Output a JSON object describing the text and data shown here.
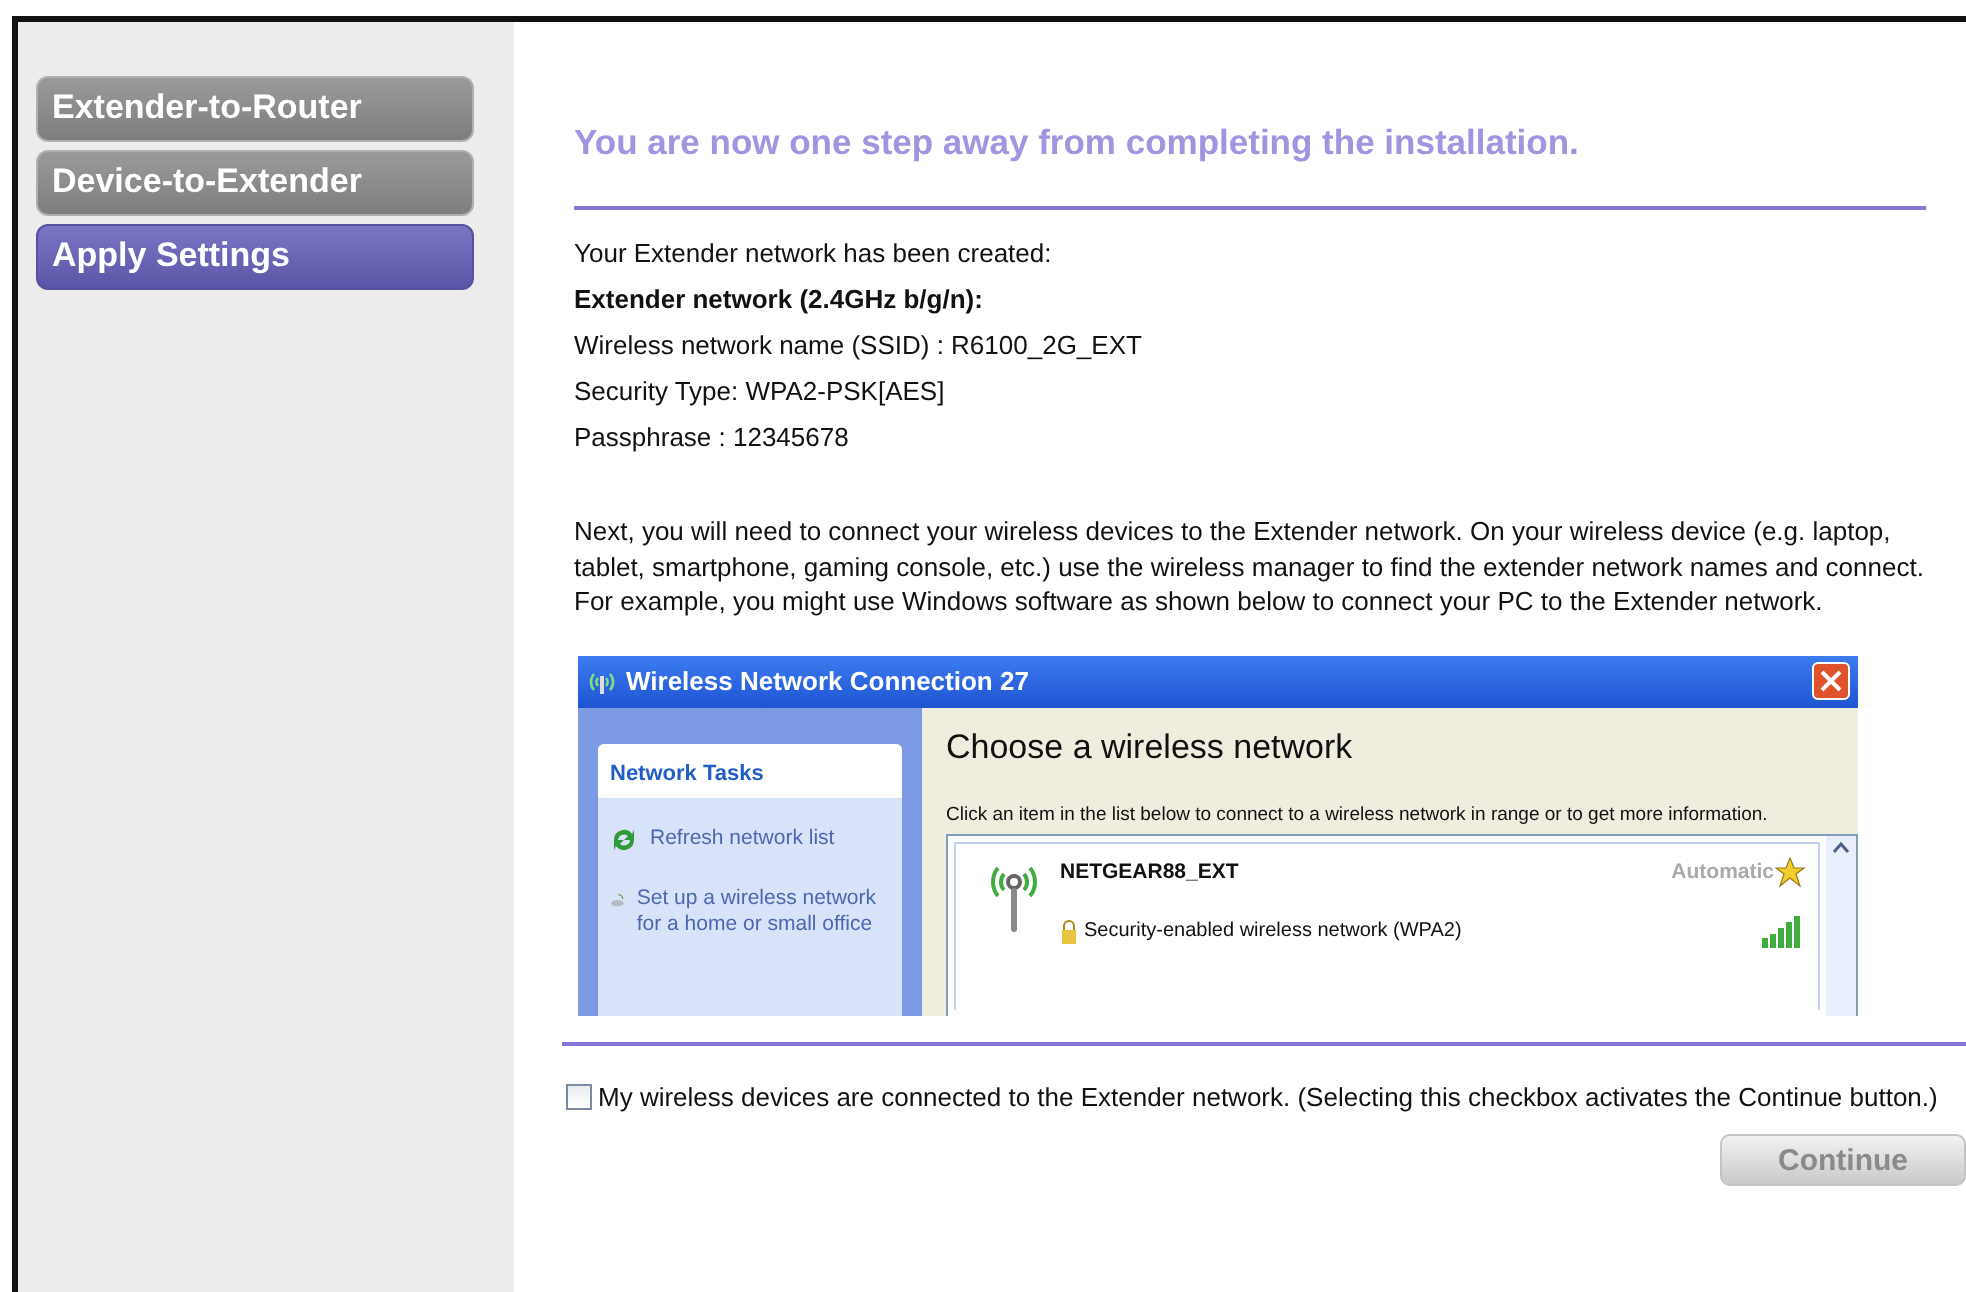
{
  "steps": [
    {
      "label": "Extender-to-Router",
      "selected": false
    },
    {
      "label": "Device-to-Extender",
      "selected": false
    },
    {
      "label": "Apply Settings",
      "selected": true
    }
  ],
  "title": "You are now one step away from completing the installation.",
  "info": [
    {
      "text": "Your Extender network has been created:",
      "kind": "plain"
    },
    {
      "text": "Extender network (2.4GHz b/g/n):",
      "kind": "heading"
    },
    {
      "text": "Wireless network name (SSID) : R6100_2G_EXT",
      "kind": "plain"
    },
    {
      "text": "Security Type: WPA2-PSK[AES]",
      "kind": "plain"
    },
    {
      "text": "Passphrase : 12345678",
      "kind": "plain"
    }
  ],
  "instructions": "Next, you will need to connect your wireless devices to the Extender network. On your wireless device (e.g. laptop, tablet, smartphone, gaming console, etc.) use the wireless manager to find the extender network names and connect. For example, you might use Windows software as shown below to connect your PC to the Extender network.",
  "example_window": {
    "title": "Wireless Network Connection 27",
    "tasks_heading": "Network Tasks",
    "tasks": [
      {
        "label": "Refresh network list",
        "kind": "refresh"
      },
      {
        "label": "Set up a wireless network for a home or small office",
        "kind": "setup"
      }
    ],
    "heading": "Choose a wireless network",
    "description": "Click an item in the list below to connect to a wireless network in range or to get more information.",
    "network": {
      "name": "NETGEAR88_EXT",
      "status": "Automatic",
      "security": "Security-enabled wireless network (WPA2)"
    }
  },
  "confirm": {
    "label": "My wireless devices are connected to the Extender network. (Selecting this checkbox activates the Continue button.)",
    "checked": false
  },
  "continue_button": {
    "label": "Continue",
    "disabled": true
  }
}
